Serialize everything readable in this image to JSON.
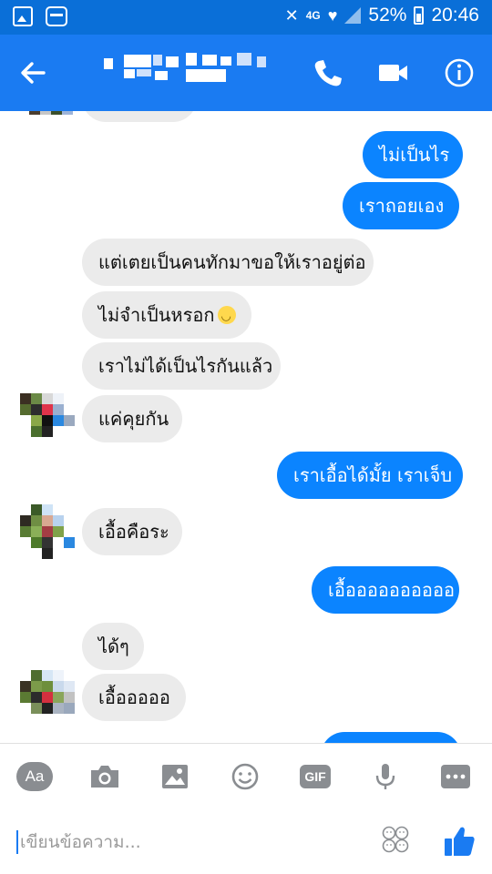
{
  "status_bar": {
    "network": "4G",
    "battery": "52%",
    "time": "20:46",
    "icons": [
      "gallery-icon",
      "card-icon",
      "mute-icon",
      "heart-notification-icon",
      "signal-icon",
      "battery-icon"
    ]
  },
  "header": {
    "icons": [
      "back-arrow-icon",
      "phone-icon",
      "video-camera-icon",
      "info-icon"
    ],
    "accent": "#1a7bf2"
  },
  "messages": [
    {
      "side": "out",
      "text": "ไม่เป็นไร"
    },
    {
      "side": "out",
      "text": "เราถอยเอง"
    },
    {
      "side": "in",
      "text": "แต่เตยเป็นคนทักมาขอให้เราอยู่ต่อ"
    },
    {
      "side": "in",
      "text": "ไม่จำเป็นหรอก",
      "emoji": "slightly-smiling-face-icon"
    },
    {
      "side": "in",
      "text": "เราไม่ได้เป็นไรกันแล้ว"
    },
    {
      "side": "in",
      "text": "แค่คุยกัน"
    },
    {
      "side": "out",
      "text": "เราเอื้อได้มั้ย เราเจ็บ"
    },
    {
      "side": "in",
      "text": "เอื้อคือระ"
    },
    {
      "side": "out",
      "text": "เอื้ออออออออออ"
    },
    {
      "side": "in",
      "text": "ได้ๆ"
    },
    {
      "side": "in",
      "text": "เอื้อออออ"
    }
  ],
  "toolbar": {
    "aa_label": "Aa",
    "gif_label": "GIF",
    "icons": [
      "text-style-icon",
      "camera-icon",
      "image-icon",
      "emoji-icon",
      "gif-icon",
      "microphone-icon",
      "more-icon"
    ]
  },
  "compose": {
    "placeholder": "เขียนข้อความ...",
    "icons": [
      "emoji-faces-icon",
      "thumbs-up-icon"
    ]
  },
  "colors": {
    "outgoing_bubble": "#0b84ff",
    "incoming_bubble": "#ebebeb",
    "status_bar": "#0a6fd8"
  }
}
